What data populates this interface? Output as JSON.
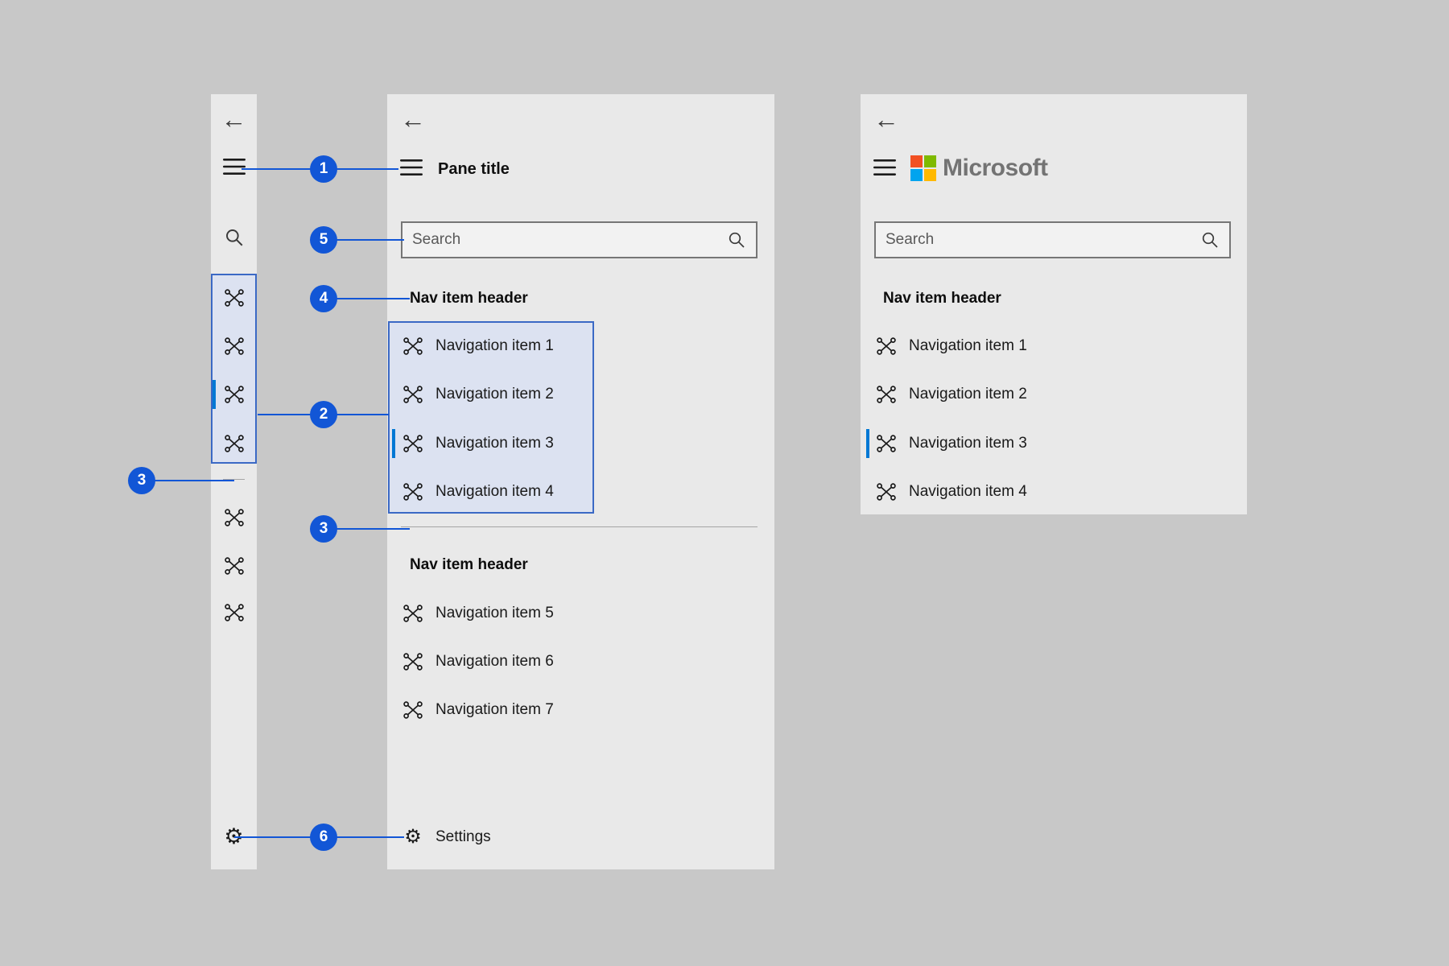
{
  "colors": {
    "page_bg": "#c8c8c8",
    "pane_bg": "#e9e9e9",
    "callout_blue": "#1256d6",
    "selection_blue": "#0078d4",
    "highlight_border": "#3b69c5",
    "highlight_fill": "#dce2f1",
    "logo_red": "#f25022",
    "logo_green": "#7fba00",
    "logo_blue": "#00a4ef",
    "logo_yellow": "#ffb900"
  },
  "icons": {
    "back_arrow": "←",
    "gear": "⚙"
  },
  "callouts": {
    "n1": "1",
    "n2": "2",
    "n3": "3",
    "n4": "4",
    "n5": "5",
    "n6": "6"
  },
  "expanded_pane": {
    "title": "Pane title",
    "search_placeholder": "Search",
    "section1_header": "Nav item header",
    "section2_header": "Nav item header",
    "items": [
      "Navigation item 1",
      "Navigation item 2",
      "Navigation item 3",
      "Navigation item 4",
      "Navigation item 5",
      "Navigation item 6",
      "Navigation item 7"
    ],
    "settings_label": "Settings"
  },
  "brand_pane": {
    "logo_text": "Microsoft",
    "search_placeholder": "Search",
    "header": "Nav item header",
    "items": [
      "Navigation item 1",
      "Navigation item 2",
      "Navigation item 3",
      "Navigation item 4"
    ]
  }
}
